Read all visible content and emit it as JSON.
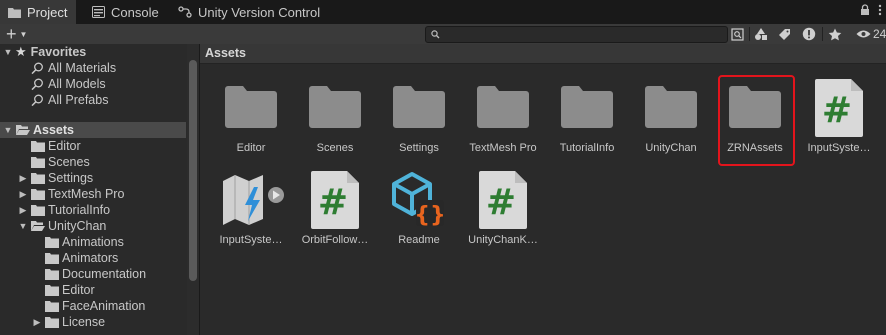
{
  "tabs": [
    {
      "label": "Project",
      "icon": "folder-icon",
      "active": true
    },
    {
      "label": "Console",
      "icon": "console-icon",
      "active": false
    },
    {
      "label": "Unity Version Control",
      "icon": "version-control-icon",
      "active": false
    }
  ],
  "tabbar_controls": {
    "lock_icon": "lock-icon",
    "menu_icon": "kebab-menu-icon"
  },
  "toolbar": {
    "create_label": "+",
    "search_placeholder": "",
    "hidden_count": "24"
  },
  "favorites": {
    "label": "Favorites",
    "items": [
      "All Materials",
      "All Models",
      "All Prefabs"
    ]
  },
  "tree": [
    {
      "label": "Assets",
      "depth": 0,
      "expanded": true,
      "selected": true
    },
    {
      "label": "Editor",
      "depth": 1,
      "expandable": false
    },
    {
      "label": "Scenes",
      "depth": 1,
      "expandable": false
    },
    {
      "label": "Settings",
      "depth": 1,
      "expandable": true
    },
    {
      "label": "TextMesh Pro",
      "depth": 1,
      "expandable": true
    },
    {
      "label": "TutorialInfo",
      "depth": 1,
      "expandable": true
    },
    {
      "label": "UnityChan",
      "depth": 1,
      "expandable": true,
      "expanded": true
    },
    {
      "label": "Animations",
      "depth": 2,
      "expandable": false
    },
    {
      "label": "Animators",
      "depth": 2,
      "expandable": false
    },
    {
      "label": "Documentation",
      "depth": 2,
      "expandable": false
    },
    {
      "label": "Editor",
      "depth": 2,
      "expandable": false
    },
    {
      "label": "FaceAnimation",
      "depth": 2,
      "expandable": false
    },
    {
      "label": "License",
      "depth": 2,
      "expandable": true
    }
  ],
  "breadcrumb": "Assets",
  "assets": [
    {
      "name": "Editor",
      "type": "folder"
    },
    {
      "name": "Scenes",
      "type": "folder"
    },
    {
      "name": "Settings",
      "type": "folder"
    },
    {
      "name": "TextMesh Pro",
      "type": "folder"
    },
    {
      "name": "TutorialInfo",
      "type": "folder"
    },
    {
      "name": "UnityChan",
      "type": "folder"
    },
    {
      "name": "ZRNAssets",
      "type": "folder",
      "highlighted": true
    },
    {
      "name": "InputSyste…",
      "type": "csharp-script"
    },
    {
      "name": "InputSyste…",
      "type": "input-actions"
    },
    {
      "name": "OrbitFollow…",
      "type": "csharp-script"
    },
    {
      "name": "Readme",
      "type": "readme"
    },
    {
      "name": "UnityChanK…",
      "type": "csharp-script"
    }
  ],
  "colors": {
    "highlight": "#e3141c",
    "script_green": "#2e7d32",
    "input_blue": "#2f8fd8",
    "readme_cyan": "#4fb3d9",
    "readme_orange": "#e8641e"
  }
}
